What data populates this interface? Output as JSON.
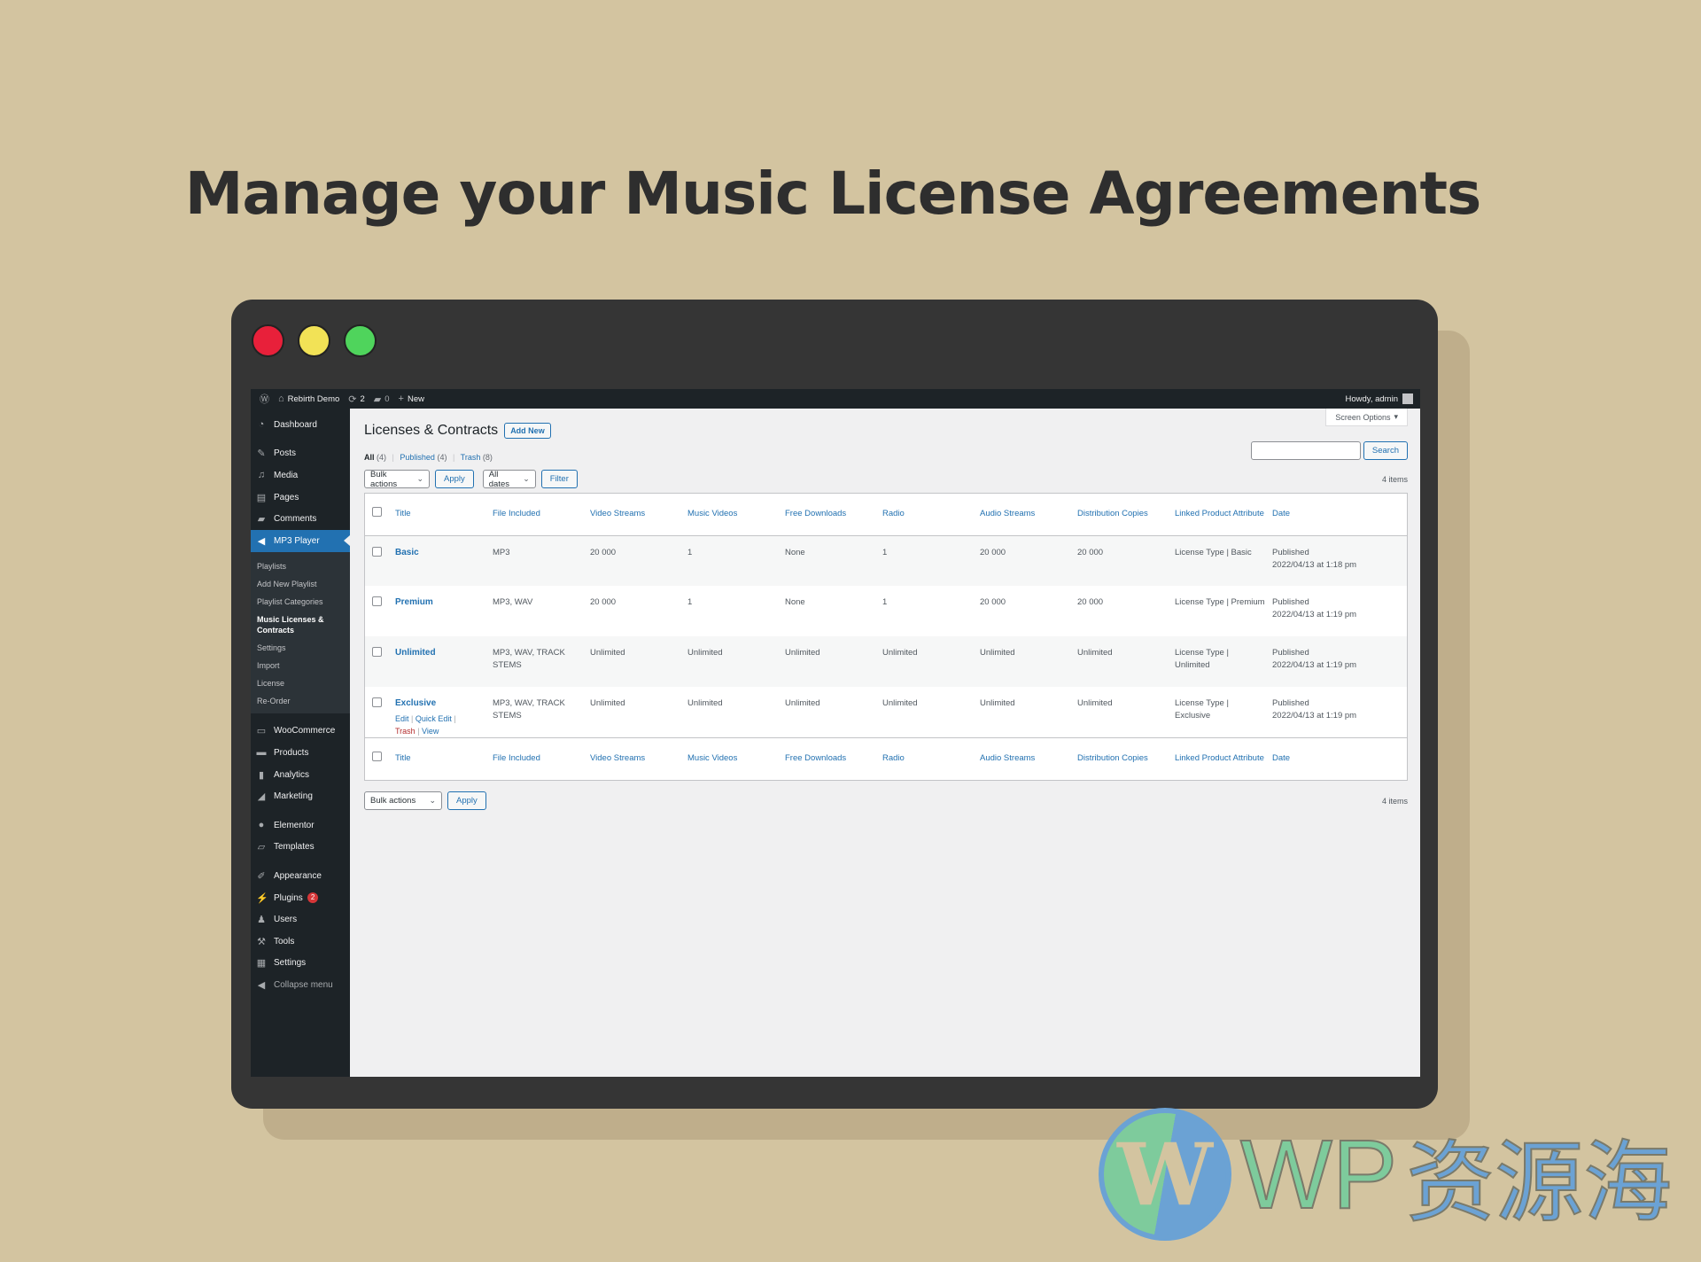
{
  "hero": {
    "title": "Manage your Music License Agreements"
  },
  "window": {
    "traffic_lights": {
      "close_color": "#e8203a",
      "minimize_color": "#f2e256",
      "maximize_color": "#4fd45c"
    }
  },
  "adminbar": {
    "site_name": "Rebirth Demo",
    "updates_count": "2",
    "comments_count": "0",
    "new_label": "New",
    "greeting": "Howdy, admin"
  },
  "sidebar": {
    "items": [
      {
        "label": "Dashboard",
        "icon": "dashboard-icon"
      },
      {
        "label": "Posts",
        "icon": "pin-icon"
      },
      {
        "label": "Media",
        "icon": "media-icon"
      },
      {
        "label": "Pages",
        "icon": "pages-icon"
      },
      {
        "label": "Comments",
        "icon": "comment-icon"
      },
      {
        "label": "MP3 Player",
        "icon": "player-icon",
        "active": true
      }
    ],
    "submenu": [
      {
        "label": "Playlists"
      },
      {
        "label": "Add New Playlist"
      },
      {
        "label": "Playlist Categories"
      },
      {
        "label": "Music Licenses & Contracts",
        "current": true
      },
      {
        "label": "Settings"
      },
      {
        "label": "Import"
      },
      {
        "label": "License"
      },
      {
        "label": "Re-Order"
      }
    ],
    "items2": [
      {
        "label": "WooCommerce",
        "icon": "woocommerce-icon"
      },
      {
        "label": "Products",
        "icon": "products-icon"
      },
      {
        "label": "Analytics",
        "icon": "analytics-icon"
      },
      {
        "label": "Marketing",
        "icon": "megaphone-icon"
      }
    ],
    "items3": [
      {
        "label": "Elementor",
        "icon": "elementor-icon"
      },
      {
        "label": "Templates",
        "icon": "folder-icon"
      }
    ],
    "items4": [
      {
        "label": "Appearance",
        "icon": "brush-icon"
      },
      {
        "label": "Plugins",
        "icon": "plugin-icon",
        "badge": "2"
      },
      {
        "label": "Users",
        "icon": "users-icon"
      },
      {
        "label": "Tools",
        "icon": "wrench-icon"
      },
      {
        "label": "Settings",
        "icon": "settings-icon"
      }
    ],
    "collapse_label": "Collapse menu"
  },
  "page": {
    "screen_options": "Screen Options",
    "title": "Licenses & Contracts",
    "add_new": "Add New",
    "filters": {
      "all_label": "All",
      "all_count": "(4)",
      "published_label": "Published",
      "published_count": "(4)",
      "trash_label": "Trash",
      "trash_count": "(8)"
    },
    "bulk_actions": "Bulk actions",
    "apply": "Apply",
    "date_filter": "All dates",
    "filter": "Filter",
    "search_value": "",
    "search_button": "Search",
    "items_count": "4 items"
  },
  "table": {
    "columns": [
      "Title",
      "File Included",
      "Video Streams",
      "Music Videos",
      "Free Downloads",
      "Radio",
      "Audio Streams",
      "Distribution Copies",
      "Linked Product Attribute",
      "Date"
    ],
    "rows": [
      {
        "title": "Basic",
        "file": "MP3",
        "video_streams": "20 000",
        "music_videos": "1",
        "free_downloads": "None",
        "radio": "1",
        "audio_streams": "20 000",
        "distribution": "20 000",
        "attribute": "License Type | Basic",
        "status": "Published",
        "date": "2022/04/13 at 1:18 pm"
      },
      {
        "title": "Premium",
        "file": "MP3, WAV",
        "video_streams": "20 000",
        "music_videos": "1",
        "free_downloads": "None",
        "radio": "1",
        "audio_streams": "20 000",
        "distribution": "20 000",
        "attribute": "License Type | Premium",
        "status": "Published",
        "date": "2022/04/13 at 1:19 pm"
      },
      {
        "title": "Unlimited",
        "file": "MP3, WAV, TRACK STEMS",
        "video_streams": "Unlimited",
        "music_videos": "Unlimited",
        "free_downloads": "Unlimited",
        "radio": "Unlimited",
        "audio_streams": "Unlimited",
        "distribution": "Unlimited",
        "attribute": "License Type | Unlimited",
        "status": "Published",
        "date": "2022/04/13 at 1:19 pm"
      },
      {
        "title": "Exclusive",
        "file": "MP3, WAV, TRACK STEMS",
        "video_streams": "Unlimited",
        "music_videos": "Unlimited",
        "free_downloads": "Unlimited",
        "radio": "Unlimited",
        "audio_streams": "Unlimited",
        "distribution": "Unlimited",
        "attribute": "License Type | Exclusive",
        "status": "Published",
        "date": "2022/04/13 at 1:19 pm"
      }
    ],
    "row_actions": {
      "edit": "Edit",
      "quick_edit": "Quick Edit",
      "trash": "Trash",
      "view": "View"
    }
  },
  "watermark": {
    "latin": "WP",
    "chinese": "资源海"
  }
}
